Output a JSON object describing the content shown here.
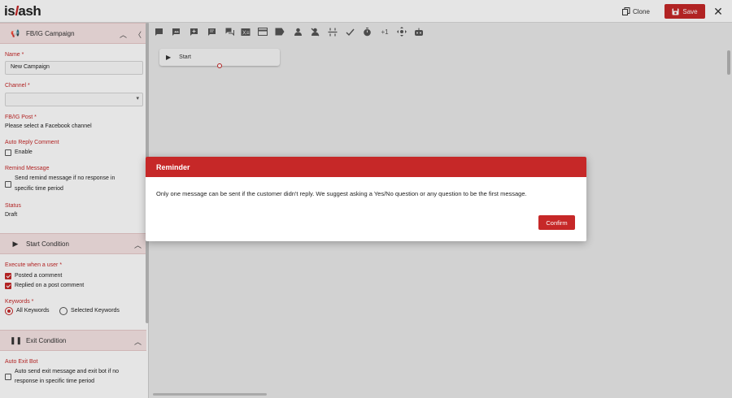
{
  "header": {
    "logo_left": "is",
    "logo_slash": "l",
    "logo_right": "ash",
    "clone_label": "Clone",
    "save_label": "Save",
    "close_symbol": "✕"
  },
  "sidebar": {
    "campaign_section": {
      "title": "FB/IG Campaign",
      "icon": "megaphone-icon"
    },
    "name": {
      "label": "Name *",
      "value": "New Campaign"
    },
    "channel": {
      "label": "Channel *",
      "value": ""
    },
    "fbig_post": {
      "label": "FB/IG Post *",
      "value": "Please select a Facebook channel"
    },
    "auto_reply": {
      "label": "Auto Reply Comment",
      "option": "Enable",
      "checked": false
    },
    "remind_message": {
      "label": "Remind Message",
      "option_line1": "Send remind message if no response in",
      "option_line2": "specific time period",
      "checked": false
    },
    "status": {
      "label": "Status",
      "value": "Draft"
    },
    "start_section": {
      "title": "Start Condition",
      "icon": "play-icon"
    },
    "execute_when": {
      "label": "Execute when a user *",
      "options": [
        {
          "text": "Posted a comment",
          "checked": true
        },
        {
          "text": "Replied on a post comment",
          "checked": true
        }
      ]
    },
    "keywords": {
      "label": "Keywords *",
      "options": [
        {
          "text": "All Keywords",
          "selected": true
        },
        {
          "text": "Selected Keywords",
          "selected": false
        }
      ]
    },
    "exit_section": {
      "title": "Exit Condition",
      "icon": "pause-icon"
    },
    "auto_exit": {
      "label": "Auto Exit Bot",
      "option_line1": "Auto send exit message and exit bot if no",
      "option_line2": "response in specific time period",
      "checked": false
    }
  },
  "toolbar": {
    "tools": [
      "message-icon",
      "image-icon",
      "add-comment-icon",
      "chat-icon",
      "forum-icon",
      "excel-icon",
      "card-icon",
      "tag-icon",
      "person-icon",
      "person-off-icon",
      "split-icon",
      "check-icon",
      "timer-icon",
      "plus-one-icon",
      "move-icon",
      "bot-icon"
    ],
    "plus_one_text": "+1"
  },
  "canvas": {
    "start_node_label": "Start"
  },
  "dialog": {
    "title": "Reminder",
    "message": "Only one message can be sent if the customer didn't reply. We suggest asking a Yes/No question or any question to be the first message.",
    "confirm_label": "Confirm"
  },
  "colors": {
    "accent": "#c62828",
    "section_bg": "#f6e5e5"
  }
}
